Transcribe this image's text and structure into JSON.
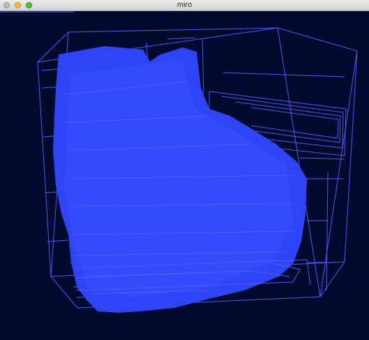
{
  "window": {
    "title": "miro",
    "controls": {
      "close": "close-icon",
      "minimize": "minimize-icon",
      "maximize": "maximize-icon"
    }
  },
  "viewport": {
    "scene": "3d-octree-wireframe-render",
    "background_color": "#000a2c",
    "wire_color": "#4b5cff",
    "fill_color": "#2f44f5"
  },
  "render_progress": 0.2
}
